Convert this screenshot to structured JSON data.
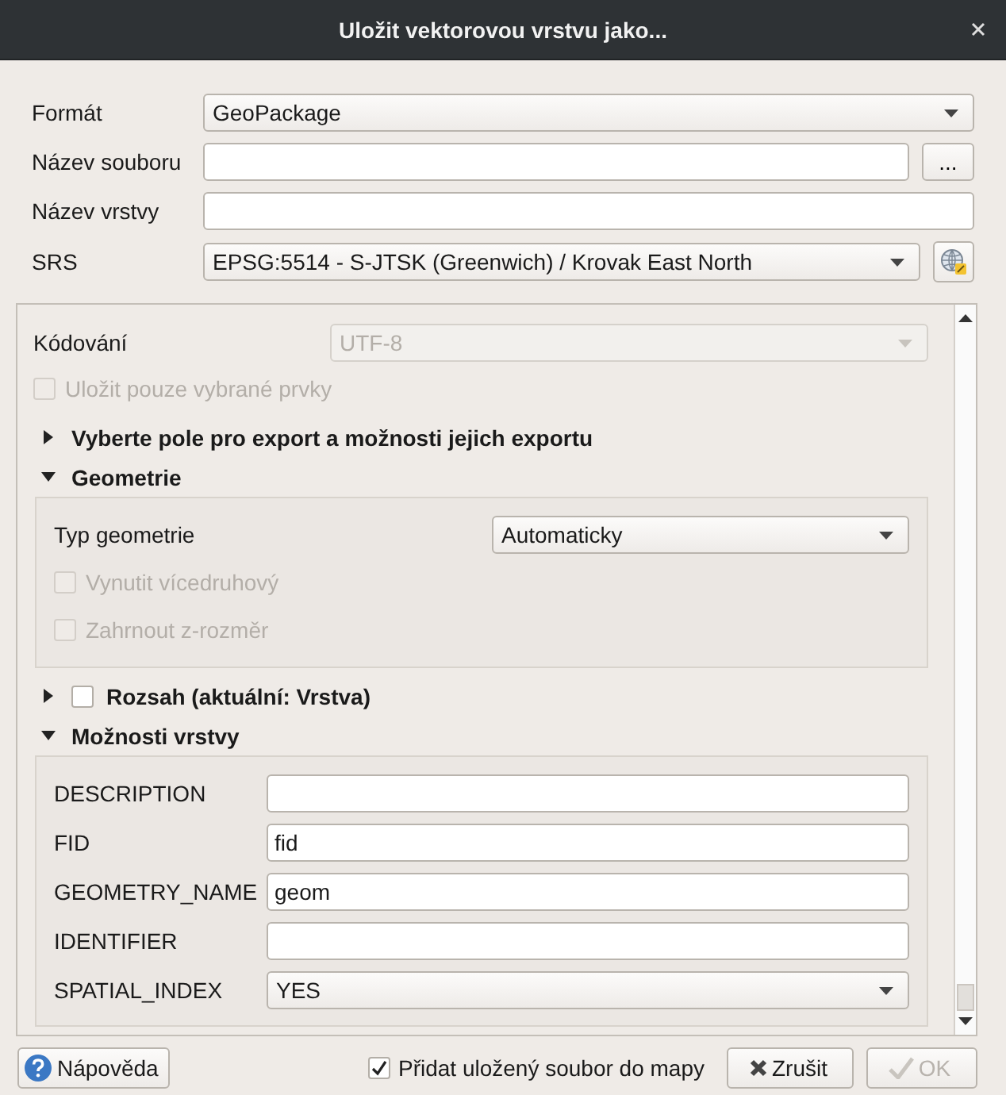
{
  "window": {
    "title": "Uložit vektorovou vrstvu jako..."
  },
  "form": [
    {
      "kind": "dropdown",
      "label": "Formát",
      "value": "GeoPackage"
    },
    {
      "kind": "file",
      "label": "Název souboru",
      "button": "..."
    },
    {
      "kind": "text",
      "label": "Název vrstvy"
    },
    {
      "kind": "crs",
      "label": "SRS",
      "value": "EPSG:5514 - S-JTSK (Greenwich) / Krovak East North"
    }
  ],
  "panel": {
    "encoding": {
      "label": "Kódování",
      "value": "UTF-8",
      "disabled": true
    },
    "selected_only": {
      "label": "Uložit pouze vybrané prvky",
      "checked": false,
      "disabled": true
    },
    "sections": [
      {
        "kind": "plain",
        "title": "Vyberte pole pro export a možnosti jejich exportu",
        "expanded": false
      },
      {
        "kind": "plain",
        "title": "Geometrie",
        "expanded": true,
        "rows": [
          {
            "kind": "dropdown",
            "label": "Typ geometrie",
            "value": "Automaticky"
          },
          {
            "kind": "checkbox",
            "label": "Vynutit vícedruhový",
            "checked": false,
            "disabled": true
          },
          {
            "kind": "checkbox",
            "label": "Zahrnout z-rozměr",
            "checked": false,
            "disabled": true
          }
        ]
      },
      {
        "kind": "checkable",
        "title": "Rozsah (aktuální: Vrstva)",
        "expanded": false,
        "checked": false
      },
      {
        "kind": "plain",
        "title": "Možnosti vrstvy",
        "expanded": true,
        "rows": [
          {
            "kind": "text",
            "label": "DESCRIPTION"
          },
          {
            "kind": "text",
            "label": "FID",
            "value": "fid"
          },
          {
            "kind": "text",
            "label": "GEOMETRY_NAME",
            "value": "geom"
          },
          {
            "kind": "text",
            "label": "IDENTIFIER"
          },
          {
            "kind": "dropdown",
            "label": "SPATIAL_INDEX",
            "value": "YES"
          }
        ]
      }
    ]
  },
  "footer": {
    "help": "Nápověda",
    "add_to_map": {
      "label": "Přidat uložený soubor do mapy",
      "checked": true
    },
    "buttons": [
      {
        "kind": "cancel",
        "label": "Zrušit",
        "disabled": false
      },
      {
        "kind": "ok",
        "label": "OK",
        "disabled": true
      }
    ]
  }
}
